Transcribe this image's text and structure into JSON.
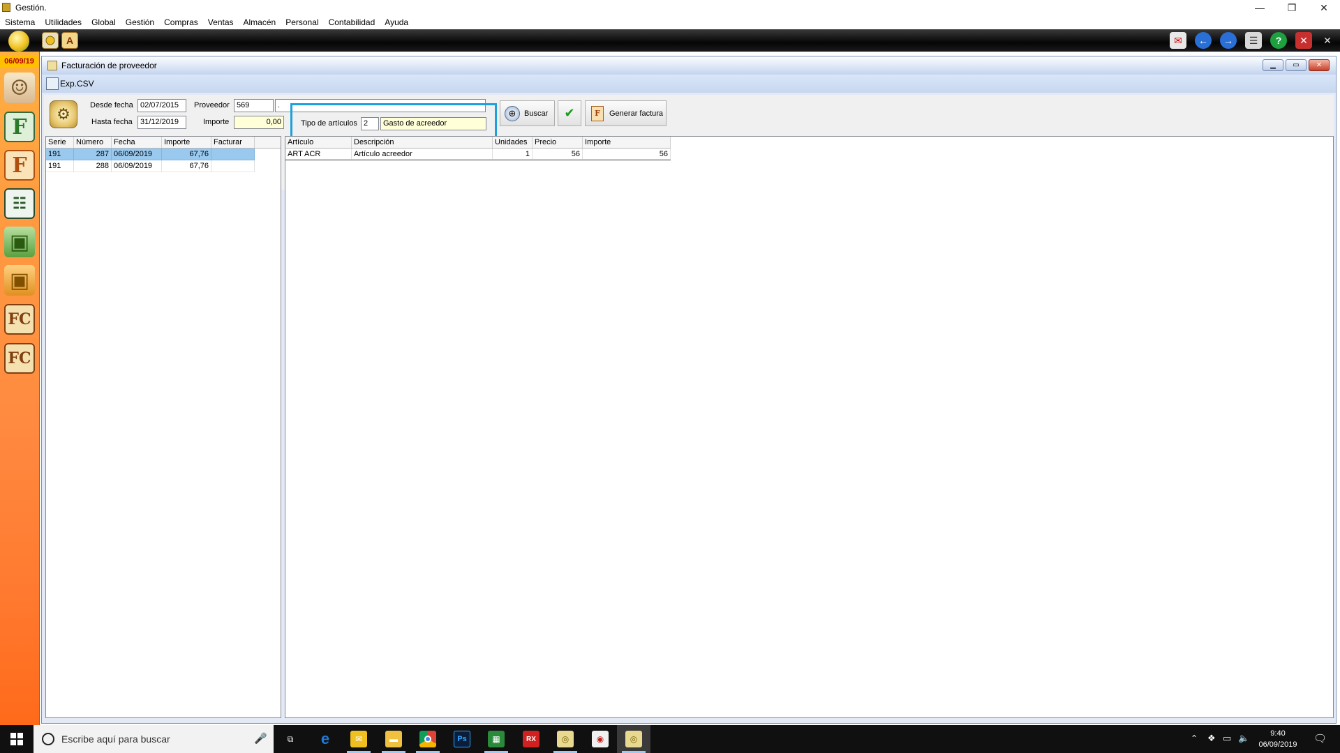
{
  "window": {
    "title": "Gestión.",
    "controls": {
      "minimize": "—",
      "restore": "❐",
      "close": "✕"
    }
  },
  "menu": [
    "Sistema",
    "Utilidades",
    "Global",
    "Gestión",
    "Compras",
    "Ventas",
    "Almacén",
    "Personal",
    "Contabilidad",
    "Ayuda"
  ],
  "sidebar": {
    "date": "06/09/19"
  },
  "child_window": {
    "title": "Facturación de proveedor",
    "csv_button": "Exp.CSV"
  },
  "filters": {
    "desde_fecha_label": "Desde fecha",
    "desde_fecha_value": "02/07/2015",
    "hasta_fecha_label": "Hasta fecha",
    "hasta_fecha_value": "31/12/2019",
    "proveedor_label": "Proveedor",
    "proveedor_code": "569",
    "proveedor_name": ".",
    "importe_label": "Importe",
    "importe_value": "0,00",
    "tipo_articulos_label": "Tipo de artículos",
    "tipo_articulos_code": "2",
    "tipo_articulos_name": "Gasto de acreedor"
  },
  "buttons": {
    "buscar": "Buscar",
    "generar_factura": "Generar factura"
  },
  "invoices": {
    "columns": [
      "Serie",
      "Número",
      "Fecha",
      "Importe",
      "Facturar"
    ],
    "rows": [
      [
        "191",
        "287",
        "06/09/2019",
        "67,76",
        ""
      ],
      [
        "191",
        "288",
        "06/09/2019",
        "67,76",
        ""
      ]
    ]
  },
  "lines": {
    "columns": [
      "Artículo",
      "Descripción",
      "Unidades",
      "Precio",
      "Importe"
    ],
    "rows": [
      [
        "ART ACR",
        "Artículo acreedor",
        "1",
        "56",
        "56"
      ]
    ]
  },
  "taskbar": {
    "search_placeholder": "Escribe aquí para buscar",
    "time": "9:40",
    "date": "06/09/2019",
    "apps": [
      "e",
      "Ps",
      "RX"
    ]
  }
}
